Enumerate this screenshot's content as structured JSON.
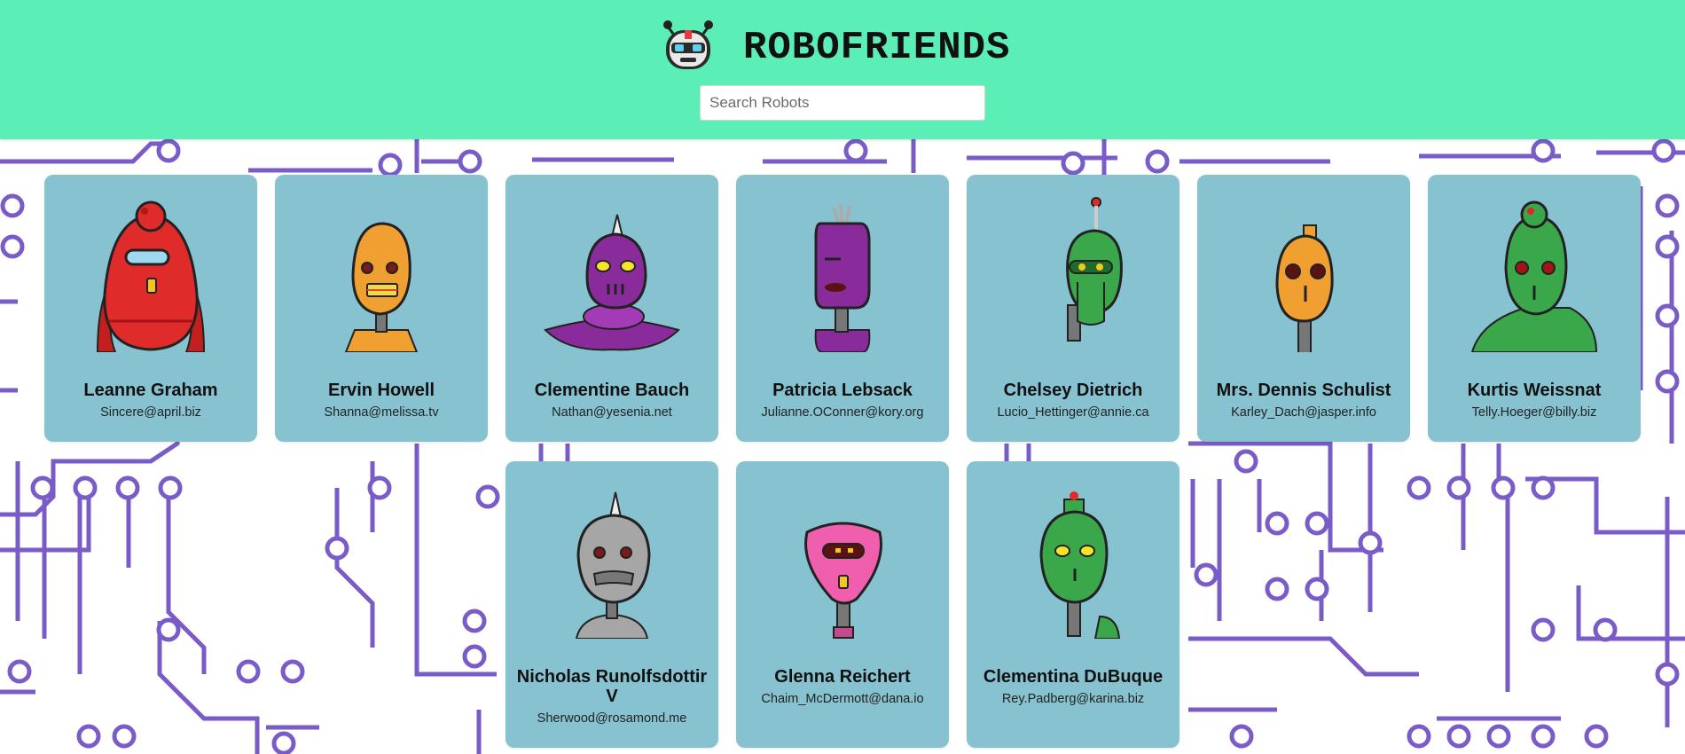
{
  "header": {
    "title": "ROBOFRIENDS",
    "logo_icon": "robot-logo-icon",
    "background": "#5beeb6"
  },
  "search": {
    "placeholder": "Search Robots",
    "value": ""
  },
  "cards": [
    {
      "name": "Leanne Graham",
      "email": "Sincere@april.biz",
      "robot_color": "#e02b2b"
    },
    {
      "name": "Ervin Howell",
      "email": "Shanna@melissa.tv",
      "robot_color": "#f0a030"
    },
    {
      "name": "Clementine Bauch",
      "email": "Nathan@yesenia.net",
      "robot_color": "#8a2b9b"
    },
    {
      "name": "Patricia Lebsack",
      "email": "Julianne.OConner@kory.org",
      "robot_color": "#8a2b9b"
    },
    {
      "name": "Chelsey Dietrich",
      "email": "Lucio_Hettinger@annie.ca",
      "robot_color": "#3aa84a"
    },
    {
      "name": "Mrs. Dennis Schulist",
      "email": "Karley_Dach@jasper.info",
      "robot_color": "#f0a030"
    },
    {
      "name": "Kurtis Weissnat",
      "email": "Telly.Hoeger@billy.biz",
      "robot_color": "#3aa84a"
    },
    {
      "name": "Nicholas Runolfsdottir V",
      "email": "Sherwood@rosamond.me",
      "robot_color": "#a6a6a6"
    },
    {
      "name": "Glenna Reichert",
      "email": "Chaim_McDermott@dana.io",
      "robot_color": "#ef5fae"
    },
    {
      "name": "Clementina DuBuque",
      "email": "Rey.Padberg@karina.biz",
      "robot_color": "#3aa84a"
    }
  ],
  "colors": {
    "card_bg": "#87c2d1",
    "circuit": "#7a5cc8"
  }
}
